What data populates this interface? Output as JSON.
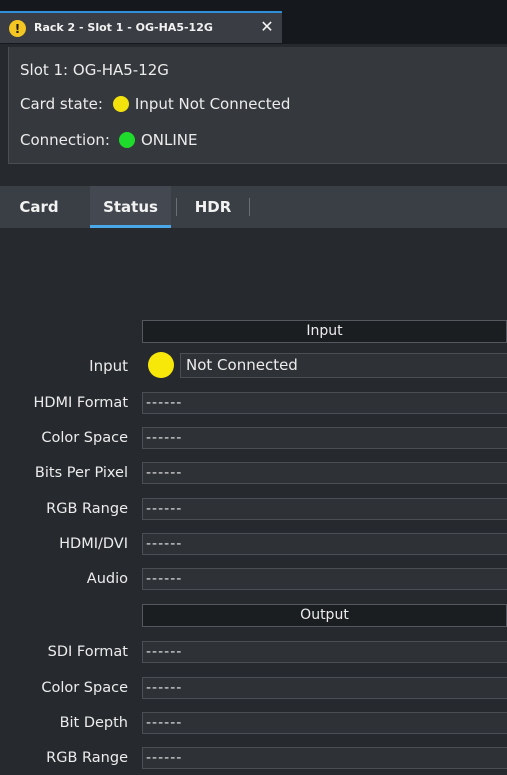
{
  "window": {
    "tab_title": "Rack 2 - Slot 1 - OG-HA5-12G",
    "warning_glyph": "!",
    "close_glyph": "✕",
    "accent": "#2f8fd8"
  },
  "header": {
    "slot": "Slot 1: OG-HA5-12G",
    "card_state_label": "Card state:",
    "card_state_value": "Input Not Connected",
    "card_state_color": "#f4e20c",
    "connection_label": "Connection:",
    "connection_value": "ONLINE",
    "connection_color": "#1fdc2c"
  },
  "tabs": [
    {
      "label": "Card",
      "active": false
    },
    {
      "label": "Status",
      "active": true
    },
    {
      "label": "HDR",
      "active": false
    }
  ],
  "status": {
    "input_section": "Input",
    "input_row": {
      "label": "Input",
      "value": "Not Connected",
      "indicator_color": "#f7e80a"
    },
    "input_rows": [
      {
        "label": "HDMI Format",
        "value": "------"
      },
      {
        "label": "Color Space",
        "value": "------"
      },
      {
        "label": "Bits Per Pixel",
        "value": "------"
      },
      {
        "label": "RGB Range",
        "value": "------"
      },
      {
        "label": "HDMI/DVI",
        "value": "------"
      },
      {
        "label": "Audio",
        "value": "------"
      }
    ],
    "output_section": "Output",
    "output_rows": [
      {
        "label": "SDI Format",
        "value": "------"
      },
      {
        "label": "Color Space",
        "value": "------"
      },
      {
        "label": "Bit Depth",
        "value": "------"
      },
      {
        "label": "RGB Range",
        "value": "------"
      }
    ]
  }
}
